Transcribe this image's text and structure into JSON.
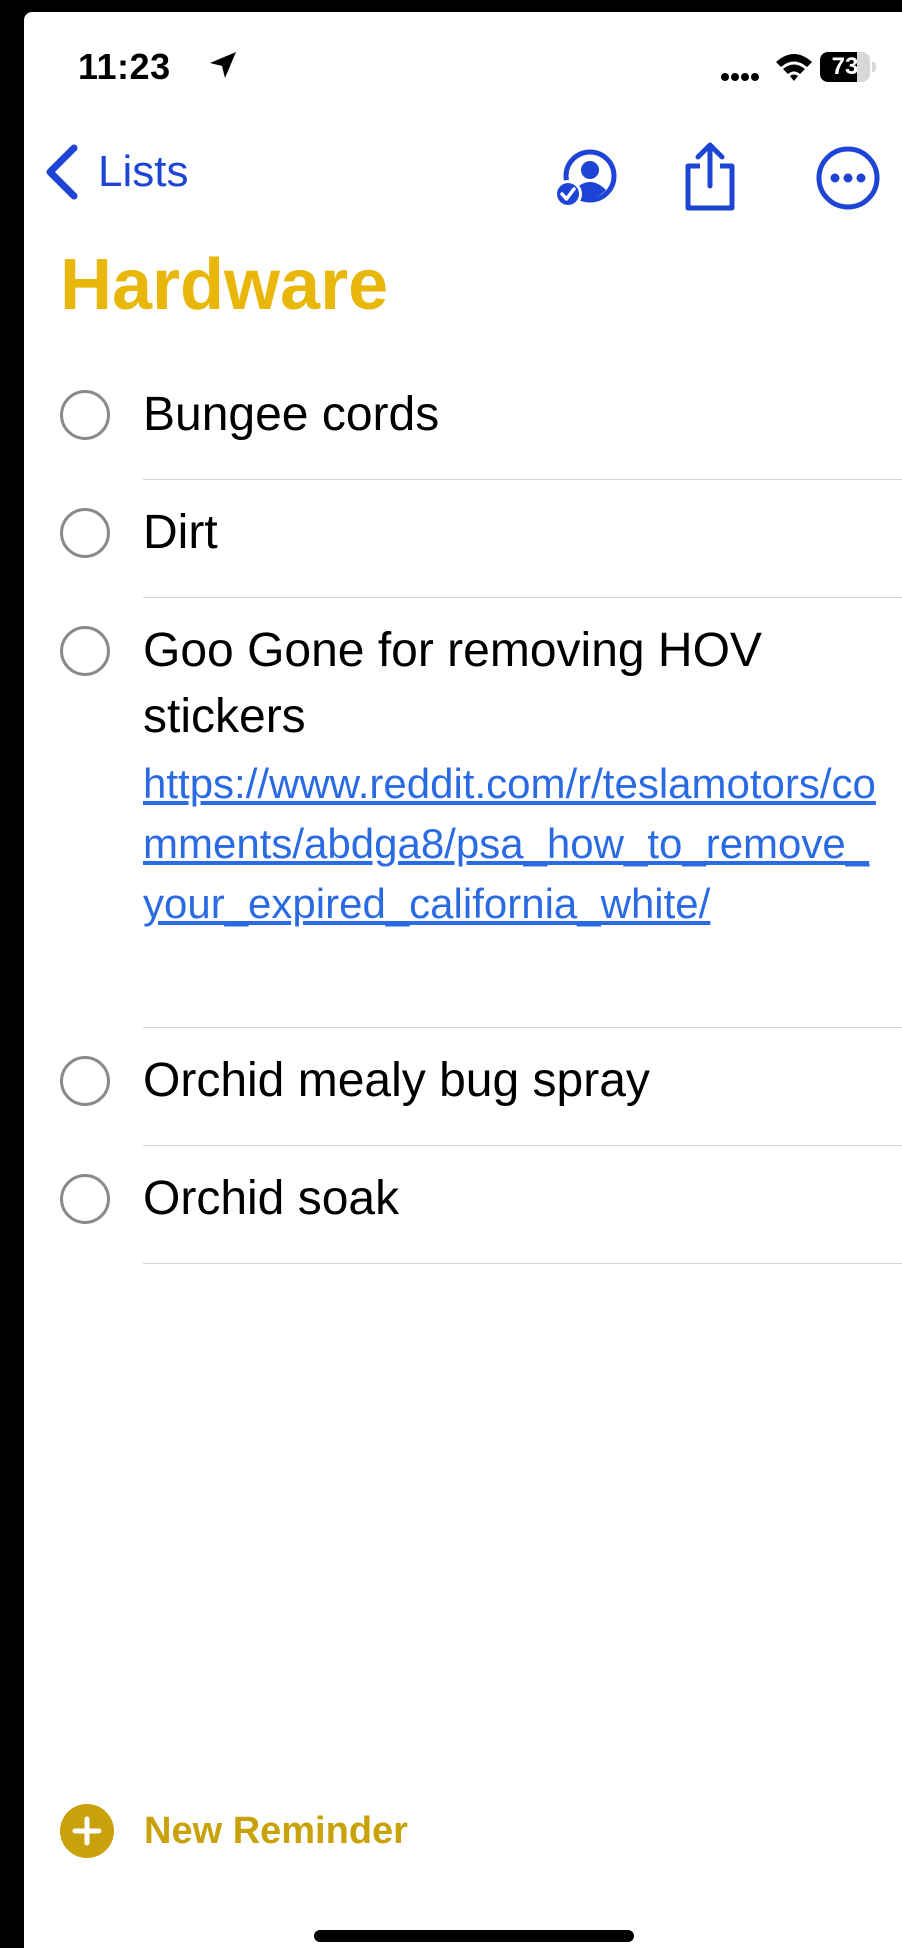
{
  "status_bar": {
    "time": "11:23",
    "battery": "73",
    "battery_level": 0.73,
    "icons": [
      "location-arrow-icon",
      "cellular-signal-icon",
      "wifi-icon",
      "battery-icon"
    ]
  },
  "nav": {
    "back_label": "Lists",
    "icons": [
      "chevron-left-icon",
      "shared-person-icon",
      "share-icon",
      "more-icon"
    ]
  },
  "list": {
    "title": "Hardware",
    "accent_color": "#e9b60a",
    "items": [
      {
        "title": "Bungee cords"
      },
      {
        "title": "Dirt"
      },
      {
        "title": "Goo Gone for removing HOV stickers",
        "link": "https://www.reddit.com/r/teslamotors/comments/abdga8/psa_how_to_remove_your_expired_california_white/"
      },
      {
        "title": "Orchid mealy bug spray"
      },
      {
        "title": "Orchid soak"
      }
    ]
  },
  "footer": {
    "new_reminder_label": "New Reminder",
    "accent_color": "#c9a20b"
  },
  "colors": {
    "tint": "#1e44d6",
    "link": "#2a6be4",
    "separator": "#d2d2d6"
  }
}
